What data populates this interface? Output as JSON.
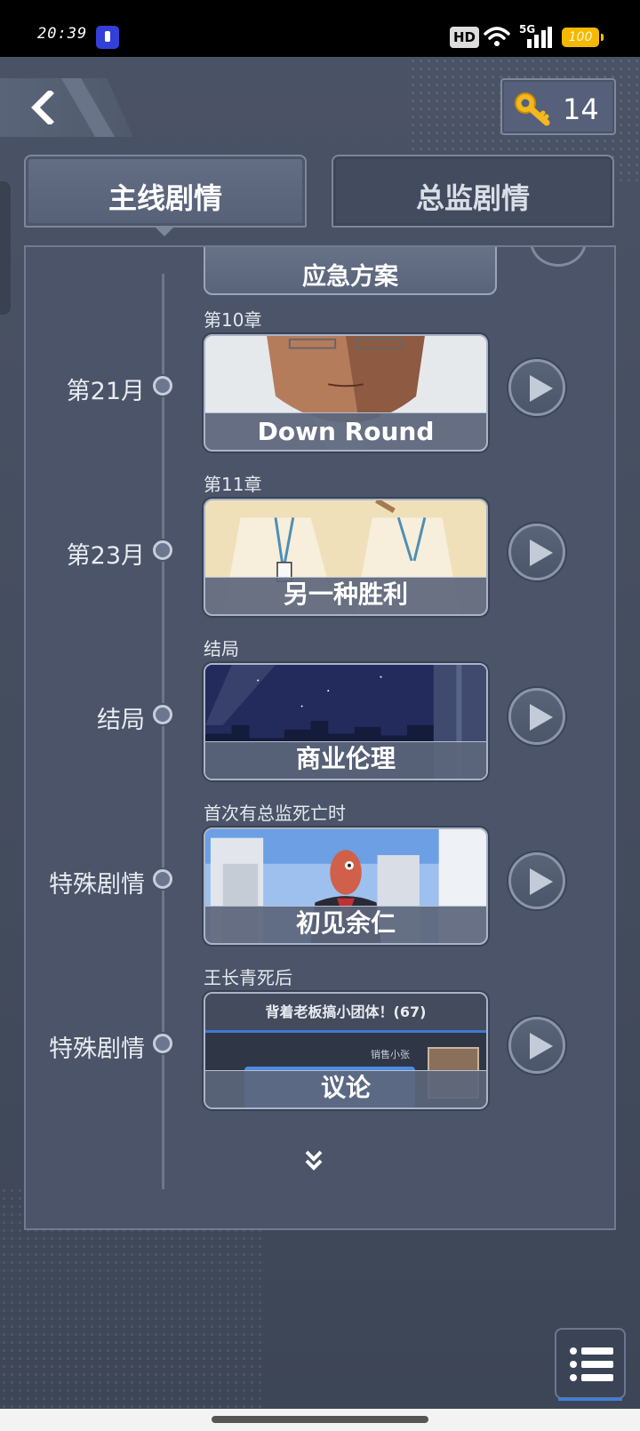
{
  "status_bar": {
    "time": "20:39",
    "hd_label": "HD",
    "network_label": "5G",
    "battery_level": "100"
  },
  "header": {
    "key_count": "14"
  },
  "tabs": [
    {
      "label": "主线剧情",
      "selected": true
    },
    {
      "label": "总监剧情",
      "selected": false
    }
  ],
  "top_card": {
    "label": "应急方案"
  },
  "entries": [
    {
      "month": "第21月",
      "chapter": "第10章",
      "title": "Down Round"
    },
    {
      "month": "第23月",
      "chapter": "第11章",
      "title": "另一种胜利"
    },
    {
      "month": "结局",
      "chapter": "结局",
      "title": "商业伦理"
    },
    {
      "month": "特殊剧情",
      "chapter": "首次有总监死亡时",
      "title": "初见余仁"
    },
    {
      "month": "特殊剧情",
      "chapter": "王长青死后",
      "title": "议论"
    }
  ],
  "discussion_preview": {
    "group_name": "背着老板搞小团体！(67)",
    "sender": "销售小张"
  },
  "colors": {
    "accent_blue": "#3c7fe0",
    "panel_bg": "#4b5468",
    "key_gold": "#f2b81e"
  },
  "icons": {
    "back": "chevron-left-icon",
    "key": "key-icon",
    "play": "play-icon",
    "more": "double-chevron-down-icon",
    "menu": "list-menu-icon"
  }
}
